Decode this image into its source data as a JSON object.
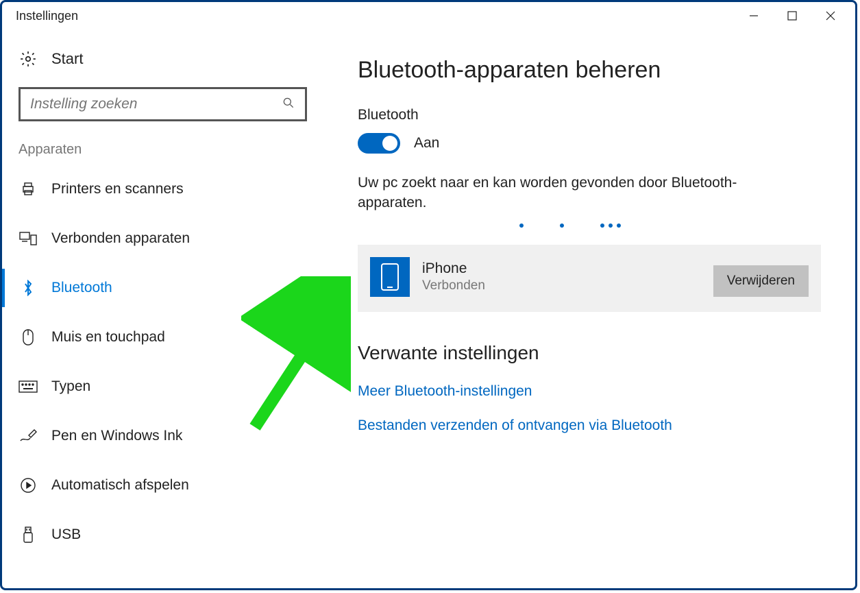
{
  "window": {
    "title": "Instellingen"
  },
  "sidebar": {
    "start": "Start",
    "search_placeholder": "Instelling zoeken",
    "section": "Apparaten",
    "items": [
      {
        "label": "Printers en scanners"
      },
      {
        "label": "Verbonden apparaten"
      },
      {
        "label": "Bluetooth"
      },
      {
        "label": "Muis en touchpad"
      },
      {
        "label": "Typen"
      },
      {
        "label": "Pen en Windows Ink"
      },
      {
        "label": "Automatisch afspelen"
      },
      {
        "label": "USB"
      }
    ]
  },
  "main": {
    "title": "Bluetooth-apparaten beheren",
    "toggle_section": "Bluetooth",
    "toggle_state": "Aan",
    "status": "Uw pc zoekt naar en kan worden gevonden door Bluetooth-apparaten.",
    "device": {
      "name": "iPhone",
      "status": "Verbonden",
      "remove": "Verwijderen"
    },
    "related_title": "Verwante instellingen",
    "related_links": [
      "Meer Bluetooth-instellingen",
      "Bestanden verzenden of ontvangen via Bluetooth"
    ]
  }
}
